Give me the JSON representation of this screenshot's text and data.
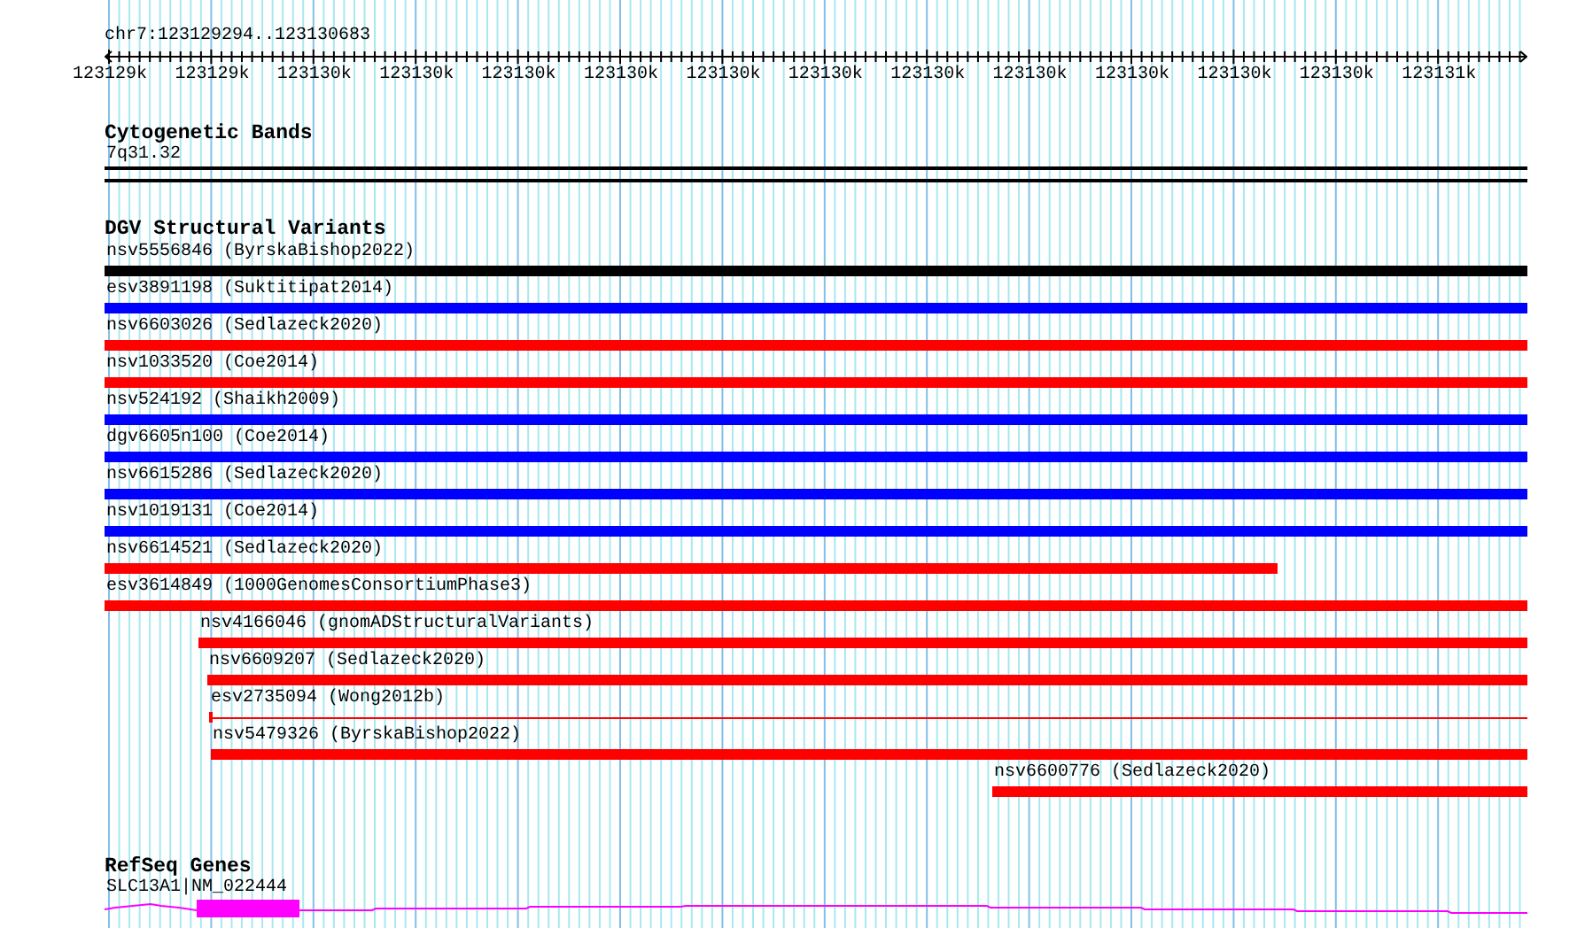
{
  "ruler": {
    "location": "chr7:123129294..123130683",
    "tick_labels": [
      "123129k",
      "123129k",
      "123130k",
      "123130k",
      "123130k",
      "123130k",
      "123130k",
      "123130k",
      "123130k",
      "123130k",
      "123130k",
      "123130k",
      "123130k",
      "123131k"
    ]
  },
  "cytogenetic_bands": {
    "title": "Cytogenetic Bands",
    "band": "7q31.32"
  },
  "structural_variants": {
    "title": "DGV Structural Variants",
    "features": [
      {
        "label": "nsv5556846 (ByrskaBishop2022)",
        "color": "#000000",
        "kind": "bar"
      },
      {
        "label": "esv3891198 (Suktitipat2014)",
        "color": "#0000ff",
        "kind": "bar"
      },
      {
        "label": "nsv6603026 (Sedlazeck2020)",
        "color": "#ff0000",
        "kind": "bar"
      },
      {
        "label": "nsv1033520 (Coe2014)",
        "color": "#ff0000",
        "kind": "bar"
      },
      {
        "label": "nsv524192 (Shaikh2009)",
        "color": "#0000ff",
        "kind": "bar"
      },
      {
        "label": "dgv6605n100 (Coe2014)",
        "color": "#0000ff",
        "kind": "bar"
      },
      {
        "label": "nsv6615286 (Sedlazeck2020)",
        "color": "#0000ff",
        "kind": "bar"
      },
      {
        "label": "nsv1019131 (Coe2014)",
        "color": "#0000ff",
        "kind": "bar"
      },
      {
        "label": "nsv6614521 (Sedlazeck2020)",
        "color": "#ff0000",
        "kind": "bar"
      },
      {
        "label": "esv3614849 (1000GenomesConsortiumPhase3)",
        "color": "#ff0000",
        "kind": "bar"
      },
      {
        "label": "nsv4166046 (gnomADStructuralVariants)",
        "color": "#ff0000",
        "kind": "bar"
      },
      {
        "label": "nsv6609207 (Sedlazeck2020)",
        "color": "#ff0000",
        "kind": "bar"
      },
      {
        "label": "esv2735094 (Wong2012b)",
        "color": "#ff0000",
        "kind": "line"
      },
      {
        "label": "nsv5479326 (ByrskaBishop2022)",
        "color": "#ff0000",
        "kind": "bar"
      },
      {
        "label": "nsv6600776 (Sedlazeck2020)",
        "color": "#ff0000",
        "kind": "bar"
      }
    ]
  },
  "refseq_genes": {
    "title": "RefSeq Genes",
    "gene": "SLC13A1|NM_022444"
  }
}
